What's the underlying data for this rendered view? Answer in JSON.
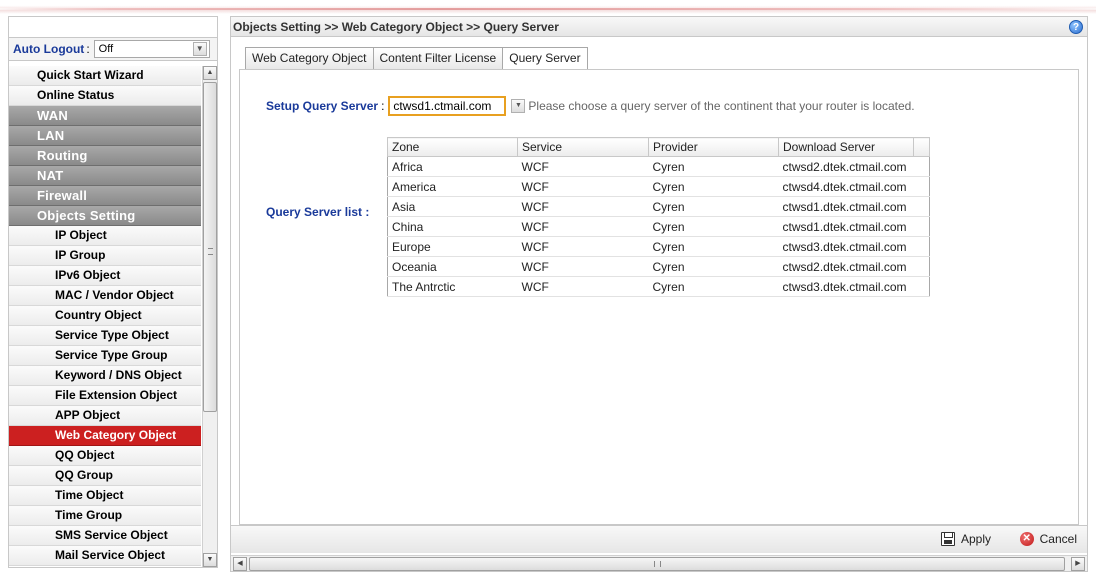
{
  "breadcrumb": "Objects Setting >> Web Category Object >> Query Server",
  "help_icon": "?",
  "auto_logout": {
    "label": "Auto Logout",
    "colon": ":",
    "value": "Off"
  },
  "menu": [
    {
      "label": "Quick Start Wizard",
      "kind": "top"
    },
    {
      "label": "Online Status",
      "kind": "top"
    },
    {
      "label": "WAN",
      "kind": "group"
    },
    {
      "label": "LAN",
      "kind": "group"
    },
    {
      "label": "Routing",
      "kind": "group"
    },
    {
      "label": "NAT",
      "kind": "group"
    },
    {
      "label": "Firewall",
      "kind": "group"
    },
    {
      "label": "Objects Setting",
      "kind": "group"
    },
    {
      "label": "IP Object",
      "kind": "sub"
    },
    {
      "label": "IP Group",
      "kind": "sub"
    },
    {
      "label": "IPv6 Object",
      "kind": "sub"
    },
    {
      "label": "MAC / Vendor Object",
      "kind": "sub"
    },
    {
      "label": "Country Object",
      "kind": "sub"
    },
    {
      "label": "Service Type Object",
      "kind": "sub"
    },
    {
      "label": "Service Type Group",
      "kind": "sub"
    },
    {
      "label": "Keyword / DNS Object",
      "kind": "sub"
    },
    {
      "label": "File Extension Object",
      "kind": "sub"
    },
    {
      "label": "APP Object",
      "kind": "sub"
    },
    {
      "label": "Web Category Object",
      "kind": "sub",
      "active": true
    },
    {
      "label": "QQ Object",
      "kind": "sub"
    },
    {
      "label": "QQ Group",
      "kind": "sub"
    },
    {
      "label": "Time Object",
      "kind": "sub"
    },
    {
      "label": "Time Group",
      "kind": "sub"
    },
    {
      "label": "SMS Service Object",
      "kind": "sub"
    },
    {
      "label": "Mail Service Object",
      "kind": "sub"
    }
  ],
  "tabs": [
    {
      "label": "Web Category Object",
      "active": false
    },
    {
      "label": "Content Filter License",
      "active": false
    },
    {
      "label": "Query Server",
      "active": true
    }
  ],
  "setup": {
    "label": "Setup Query Server",
    "colon": ":",
    "value": "ctwsd1.ctmail.com",
    "hint": "Please choose a query server of the continent that your router is located."
  },
  "list_label": "Query Server list :",
  "table": {
    "headers": [
      "Zone",
      "Service",
      "Provider",
      "Download Server"
    ],
    "rows": [
      [
        "Africa",
        "WCF",
        "Cyren",
        "ctwsd2.dtek.ctmail.com"
      ],
      [
        "America",
        "WCF",
        "Cyren",
        "ctwsd4.dtek.ctmail.com"
      ],
      [
        "Asia",
        "WCF",
        "Cyren",
        "ctwsd1.dtek.ctmail.com"
      ],
      [
        "China",
        "WCF",
        "Cyren",
        "ctwsd1.dtek.ctmail.com"
      ],
      [
        "Europe",
        "WCF",
        "Cyren",
        "ctwsd3.dtek.ctmail.com"
      ],
      [
        "Oceania",
        "WCF",
        "Cyren",
        "ctwsd2.dtek.ctmail.com"
      ],
      [
        "The Antrctic",
        "WCF",
        "Cyren",
        "ctwsd3.dtek.ctmail.com"
      ]
    ]
  },
  "footer": {
    "apply_label": "Apply",
    "cancel_label": "Cancel"
  },
  "colors": {
    "active_menu": "#cc2020",
    "label_blue": "#1a3a9a",
    "input_focus": "#e8a020"
  }
}
